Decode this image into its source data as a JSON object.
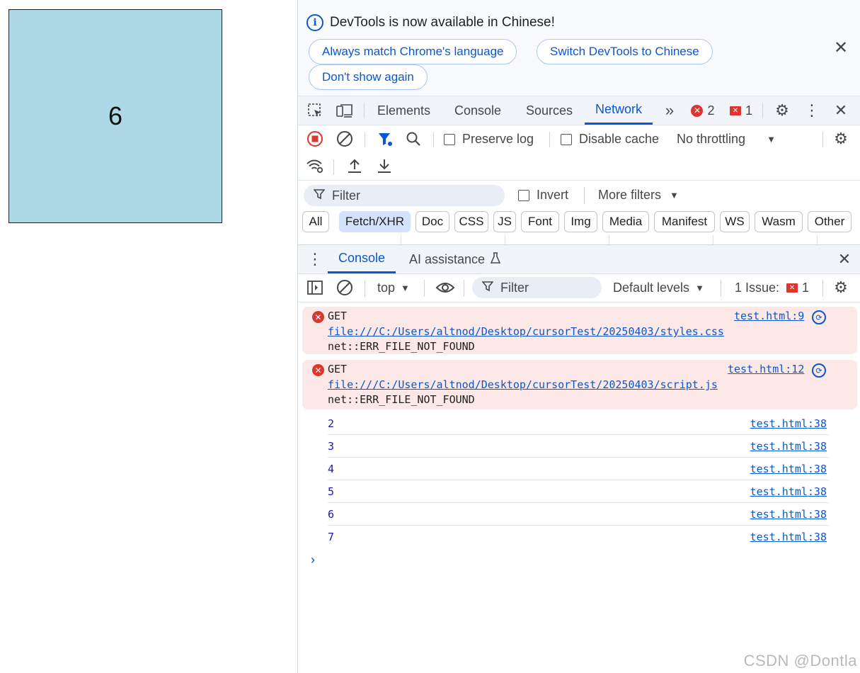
{
  "page": {
    "box_number": "6"
  },
  "infobar": {
    "title": "DevTools is now available in Chinese!",
    "btn_match": "Always match Chrome's language",
    "btn_switch": "Switch DevTools to Chinese",
    "btn_dont_show": "Don't show again"
  },
  "tabs": {
    "items": [
      "Elements",
      "Console",
      "Sources",
      "Network"
    ],
    "active": "Network",
    "error_count": "2",
    "issue_count": "1"
  },
  "network_toolbar": {
    "preserve_log": "Preserve log",
    "disable_cache": "Disable cache",
    "throttling": "No throttling"
  },
  "filter_bar": {
    "filter_placeholder": "Filter",
    "invert": "Invert",
    "more_filters": "More filters"
  },
  "type_filters": [
    "All",
    "Fetch/XHR",
    "Doc",
    "CSS",
    "JS",
    "Font",
    "Img",
    "Media",
    "Manifest",
    "WS",
    "Wasm",
    "Other"
  ],
  "type_selected": "Fetch/XHR",
  "drawer": {
    "tab_console": "Console",
    "tab_ai": "AI assistance"
  },
  "console_toolbar": {
    "context": "top",
    "filter_placeholder": "Filter",
    "levels": "Default levels",
    "issues_label": "1 Issue:",
    "issues_count": "1"
  },
  "console": {
    "errors": [
      {
        "method": "GET",
        "url": "file:///C:/Users/altnod/Desktop/cursorTest/20250403/styles.css",
        "message": "net::ERR_FILE_NOT_FOUND",
        "source": "test.html:9"
      },
      {
        "method": "GET",
        "url": "file:///C:/Users/altnod/Desktop/cursorTest/20250403/script.js",
        "message": "net::ERR_FILE_NOT_FOUND",
        "source": "test.html:12"
      }
    ],
    "logs": [
      {
        "value": "2",
        "source": "test.html:38"
      },
      {
        "value": "3",
        "source": "test.html:38"
      },
      {
        "value": "4",
        "source": "test.html:38"
      },
      {
        "value": "5",
        "source": "test.html:38"
      },
      {
        "value": "6",
        "source": "test.html:38"
      },
      {
        "value": "7",
        "source": "test.html:38"
      }
    ]
  },
  "watermark": "CSDN @Dontla",
  "colors": {
    "accent": "#0b57d0",
    "error_bg": "#fce8e6",
    "box_bg": "#add8e6"
  }
}
